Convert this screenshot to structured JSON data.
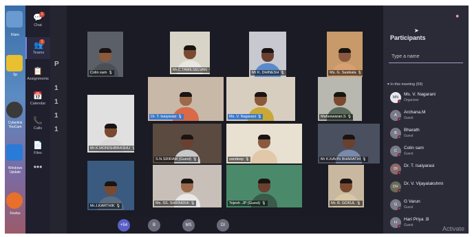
{
  "rail": {
    "items": [
      {
        "label": "Chat",
        "glyph": "💬",
        "badge": "1"
      },
      {
        "label": "Teams",
        "glyph": "👥",
        "badge": "1",
        "active": true
      },
      {
        "label": "Assignments",
        "glyph": "📋"
      },
      {
        "label": "Calendar",
        "glyph": "📅"
      },
      {
        "label": "Calls",
        "glyph": "📞",
        "badge": ""
      },
      {
        "label": "Files",
        "glyph": "📄"
      }
    ],
    "more": "•••"
  },
  "desktop": {
    "labels": [
      "Ktaro",
      "Sp",
      "Cyberlink YouCam",
      "Windows Update",
      "Firefox"
    ]
  },
  "behind_panel": {
    "letters": [
      "P",
      "1",
      "1",
      "1",
      "1"
    ]
  },
  "tiles": [
    {
      "name": "Colin sam",
      "bg": "#5a5f68",
      "skin": "#8a5a3c",
      "shirt": "#4a4f58"
    },
    {
      "name": "Mr.C.TAMILSELVAN",
      "bg": "#d8d4c8",
      "skin": "#7a4a30",
      "shirt": "#e8e6e0"
    },
    {
      "name": "Mr K. DHINESH",
      "bg": "#c8c8d0",
      "skin": "#6a4030",
      "shirt": "#5a8ac8"
    },
    {
      "name": "Ms. G. Sasikala",
      "bg": "#c89a6a",
      "skin": "#8a5a40",
      "shirt": "#d8a070"
    },
    {
      "name": "Dr. T. Isaiyarasi",
      "bg": "#c8b8a8",
      "skin": "#9a6a4a",
      "shirt": "#d86a4a"
    },
    {
      "name": "Ms. V. Nagarani",
      "bg": "#d8cec0",
      "skin": "#8a5a3a",
      "shirt": "#c8a838"
    },
    {
      "name": "Maheswaran.S",
      "bg": "#b8b8b0",
      "skin": "#7a4a30",
      "shirt": "#5a6a5a"
    },
    {
      "name": "Mr K.MONISHBRASHU",
      "bg": "#e0e0e0",
      "skin": "#7a4a30",
      "shirt": "#d8d8d8"
    },
    {
      "name": "S.N.SRIRAM (Guest)",
      "bg": "#5a4a40",
      "skin": "#6a4030",
      "shirt": "#c8c8c8"
    },
    {
      "name": "sandeep",
      "bg": "#e8e0d0",
      "skin": "#8a5a40",
      "shirt": "#e0c8a8"
    },
    {
      "name": "Mr K.KAVIN BHARATHI",
      "bg": "#4a5060",
      "skin": "#6a4030",
      "shirt": "#7a8aa8"
    },
    {
      "name": "Mr.J.KARTHIK",
      "bg": "#3a5a80",
      "skin": "#7a4a30",
      "shirt": "#5a6a80"
    },
    {
      "name": "Ms. SS. SHRINIDHI",
      "bg": "#c8c0b8",
      "skin": "#9a6a4a",
      "shirt": "#e8e8e8"
    },
    {
      "name": "Tejesh .JP (Guest)",
      "bg": "#4a8a6a",
      "skin": "#6a4030",
      "shirt": "#3a5a4a"
    },
    {
      "name": "Mr. B. GOKUL",
      "bg": "#c8b8a0",
      "skin": "#7a4a30",
      "shirt": "#d8c8a8"
    }
  ],
  "control_bar": {
    "avatars": [
      {
        "text": "+54",
        "color": "#5b5fc7"
      },
      {
        "text": "B",
        "color": "#6a6a7a"
      },
      {
        "text": "MS",
        "color": "#6a6a7a"
      },
      {
        "text": "DI",
        "color": "#6a6a7a"
      }
    ]
  },
  "participants": {
    "title": "Participants",
    "search_placeholder": "Type a name",
    "section": "In this meeting (59)",
    "people": [
      {
        "initials": "MN",
        "name": "Ms. V. Nagarani",
        "role": "Organizer",
        "color": "#e8e8f0"
      },
      {
        "initials": "A",
        "name": "Archana.M",
        "role": "Guest",
        "color": "#7a7a8a"
      },
      {
        "initials": "B",
        "name": "Bharath",
        "role": "Guest",
        "color": "#7a7a8a"
      },
      {
        "initials": "C",
        "name": "Colin sam",
        "role": "Guest",
        "color": "#7a7a8a"
      },
      {
        "initials": "DI",
        "name": "Dr. T. Isaiyarasi",
        "role": "",
        "color": "#8a6a6a"
      },
      {
        "initials": "DV",
        "name": "Dr. V. Vijayalakshmi",
        "role": "",
        "color": "#6a6a5a"
      },
      {
        "initials": "G",
        "name": "G Varun",
        "role": "Guest",
        "color": "#7a7a8a"
      },
      {
        "initials": "H",
        "name": "Hari Priya .B",
        "role": "Guest",
        "color": "#7a7a8a"
      }
    ]
  },
  "watermark": "Activate"
}
